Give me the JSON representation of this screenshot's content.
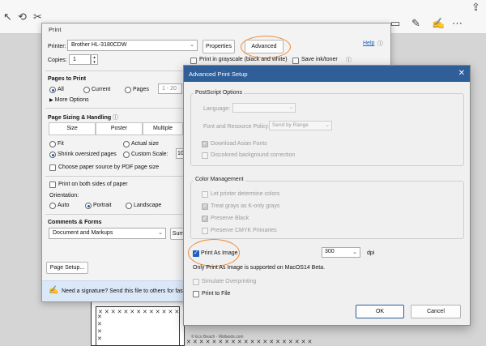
{
  "toolbar": {
    "icons": [
      "cursor-icon",
      "undo-icon",
      "scissors-icon",
      "comment-icon",
      "highlight-icon",
      "sign-icon",
      "share-icon",
      "more-icon"
    ]
  },
  "background_doc": {
    "credit": "© Eco Beach - Midlands.com"
  },
  "print_dialog": {
    "title": "Print",
    "printer_label": "Printer:",
    "printer_value": "Brother HL-3180CDW",
    "properties_label": "Properties",
    "advanced_label": "Advanced",
    "help_label": "Help",
    "copies_label": "Copies:",
    "copies_value": "1",
    "grayscale_label": "Print in grayscale (black and white)",
    "save_ink_label": "Save ink/toner",
    "pages_to_print": "Pages to Print",
    "all_label": "All",
    "current_label": "Current",
    "pages_label": "Pages",
    "pages_value": "1 - 20",
    "more_options": "More Options",
    "page_sizing": "Page Sizing & Handling",
    "size_tab": "Size",
    "poster_tab": "Poster",
    "multiple_tab": "Multiple",
    "fit_label": "Fit",
    "actual_size_label": "Actual size",
    "shrink_label": "Shrink oversized pages",
    "custom_scale_label": "Custom Scale:",
    "custom_scale_value": "10",
    "paper_source_label": "Choose paper source by PDF page size",
    "both_sides_label": "Print on both sides of paper",
    "orientation_label": "Orientation:",
    "auto_label": "Auto",
    "portrait_label": "Portrait",
    "landscape_label": "Landscape",
    "comments_forms": "Comments & Forms",
    "comments_value": "Document and Markups",
    "summarize_label": "Sum",
    "page_setup_label": "Page Setup...",
    "banner_text": "Need a signature? Send this file to others for fast,"
  },
  "advanced_dialog": {
    "title": "Advanced Print Setup",
    "postscript_options": "PostScript Options",
    "language_label": "Language:",
    "font_policy_label": "Font and Resource Policy:",
    "font_policy_value": "Send by Range",
    "download_fonts_label": "Download Asian Fonts",
    "discolored_bg_label": "Discolored background correction",
    "color_management": "Color Management",
    "let_printer_label": "Let printer determine colors",
    "treat_grays_label": "Treat grays as K-only grays",
    "preserve_black_label": "Preserve Black",
    "preserve_cmyk_label": "Preserve CMYK Primaries",
    "print_as_image_label": "Print As Image",
    "dpi_value": "300",
    "dpi_unit": "dpi",
    "macos_note": "Only Print As Image is supported on MacOS14 Beta.",
    "simulate_overprint_label": "Simulate Overprinting",
    "print_to_file_label": "Print to File",
    "ok_label": "OK",
    "cancel_label": "Cancel"
  },
  "colors": {
    "accent": "#2f5e98",
    "highlight_oval": "#ef8a32",
    "banner": "#dbe8f8"
  }
}
